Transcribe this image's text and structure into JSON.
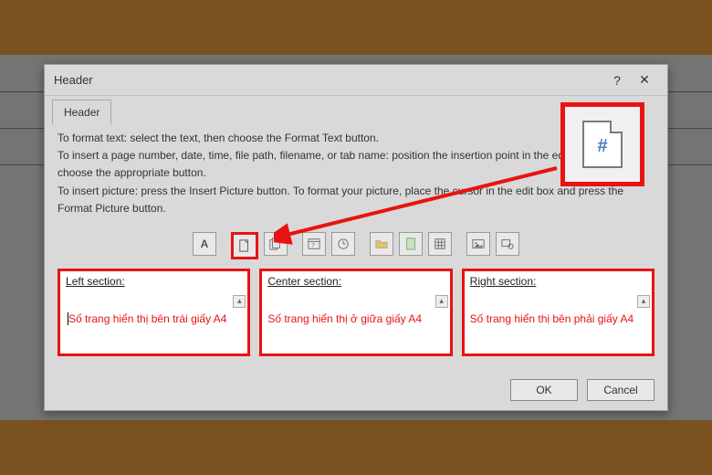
{
  "dialog": {
    "title": "Header",
    "tab_label": "Header",
    "instructions": {
      "line1": "To format text:  select the text, then choose the Format Text button.",
      "line2": "To insert a page number, date, time, file path, filename, or tab name:  position the insertion point in the edit box, then choose the appropriate button.",
      "line3": "To insert picture: press the Insert Picture button.  To format your picture, place the cursor in the edit box and press the Format Picture button."
    },
    "toolbar": {
      "format_text": "A",
      "page_number": "#",
      "pages": "##",
      "date": "7",
      "time": "●",
      "file_path": "",
      "file_name": "",
      "sheet_name": "",
      "picture": "",
      "format_picture": ""
    },
    "sections": {
      "left": {
        "prefix": "L",
        "label": "eft section:",
        "text": "Số trang hiển thị bên trái giấy A4"
      },
      "center": {
        "prefix": "C",
        "label": "enter section:",
        "text": "Số trang hiển thị ở giữa giấy A4"
      },
      "right": {
        "prefix": "R",
        "label": "ight section:",
        "text": "Số trang hiển thị bên phải giấy A4"
      }
    },
    "buttons": {
      "ok": "OK",
      "cancel": "Cancel"
    }
  },
  "callout": {
    "icon": "page-number-icon",
    "symbol": "#"
  }
}
